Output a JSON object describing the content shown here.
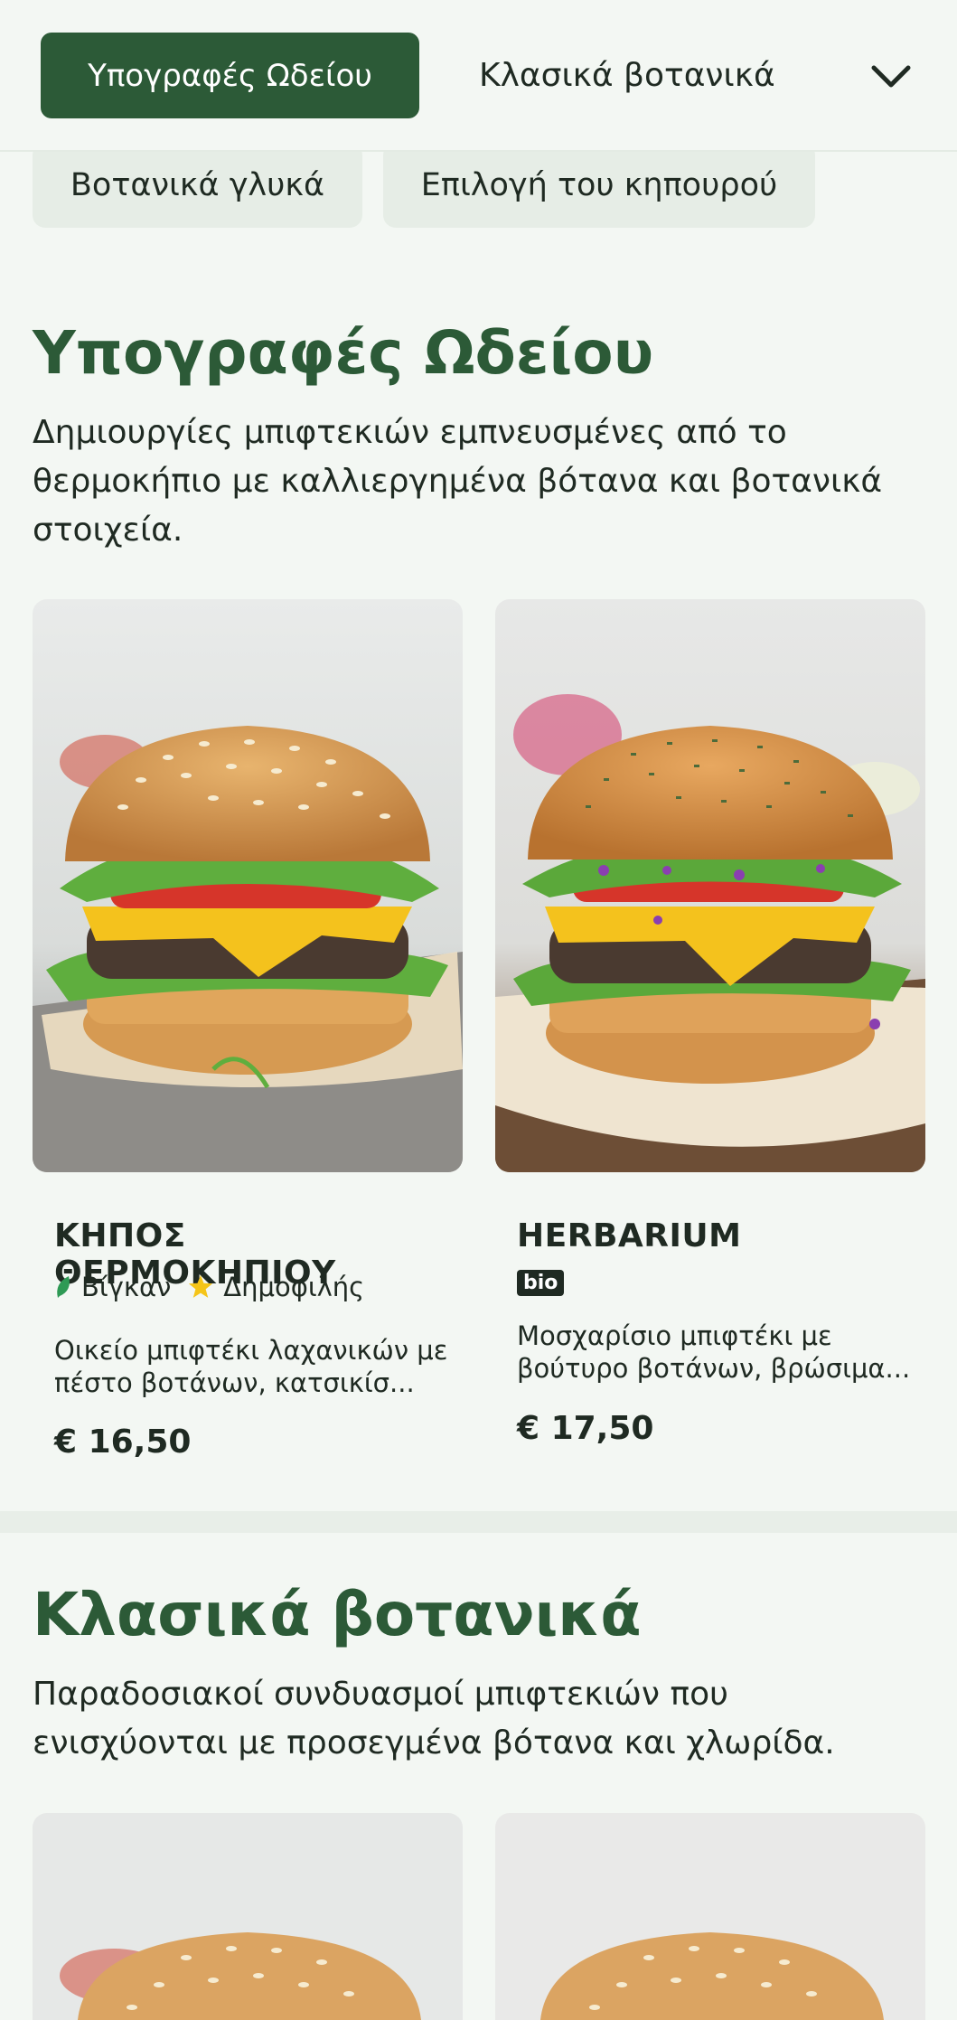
{
  "nav": {
    "active_category": "Υπογραφές Ωδείου",
    "next_category": "Κλασικά βοτανικά",
    "chips": [
      "Βοτανικά γλυκά",
      "Επιλογή του κηπουρού"
    ],
    "expand_icon": "chevron-down-icon"
  },
  "sections": [
    {
      "title": "Υπογραφές Ωδείου",
      "description": "Δημιουργίες μπιφτεκιών εμπνευσμένες από το θερμοκήπιο με καλλιεργημένα βότανα και βοτανικά στοιχεία.",
      "items": [
        {
          "name": "ΚΗΠΟΣ ΘΕΡΜΟΚΗΠΙΟΥ",
          "badges": {
            "vegan": "Βίγκαν",
            "popular": "Δημοφιλής"
          },
          "description": "Οικείο μπιφτέκι λαχανικών με πέστο βοτάνων, κατσικίσ...",
          "price": "€ 16,50"
        },
        {
          "name": "HERBARIUM",
          "badges": {
            "bio": "bio"
          },
          "description": "Μοσχαρίσιο μπιφτέκι με βούτυρο βοτάνων, βρώσιμα...",
          "price": "€ 17,50"
        }
      ]
    },
    {
      "title": "Κλασικά βοτανικά",
      "description": "Παραδοσιακοί συνδυασμοί μπιφτεκιών που ενισχύονται με προσεγμένα βότανα και χλωρίδα."
    }
  ],
  "colors": {
    "brand_green": "#2c5a37",
    "background": "#f3f7f3",
    "chip_bg": "#e6ede6",
    "popular_star": "#f5c518",
    "vegan_leaf": "#2e9a55"
  }
}
